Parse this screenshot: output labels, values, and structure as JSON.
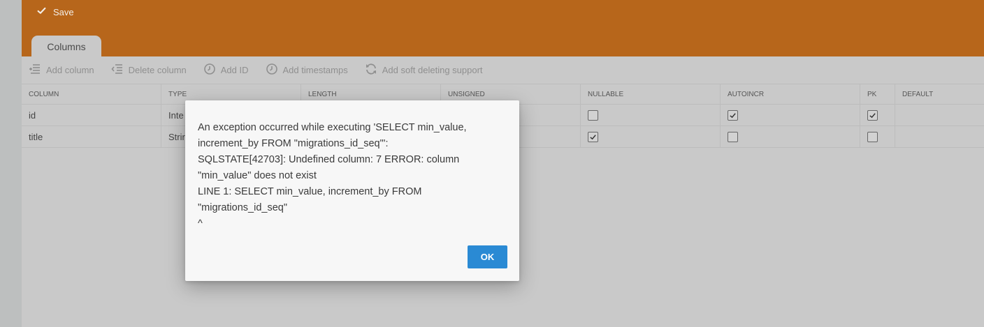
{
  "header": {
    "save_label": "Save",
    "save_icon": "check-icon"
  },
  "tabs": [
    {
      "label": "Columns"
    }
  ],
  "toolbar": {
    "items": [
      {
        "label": "Add column",
        "icon": "add-column-icon"
      },
      {
        "label": "Delete column",
        "icon": "delete-column-icon"
      },
      {
        "label": "Add ID",
        "icon": "clock-icon"
      },
      {
        "label": "Add timestamps",
        "icon": "clock-icon"
      },
      {
        "label": "Add soft deleting support",
        "icon": "refresh-icon"
      }
    ]
  },
  "table": {
    "headers": [
      "COLUMN",
      "TYPE",
      "LENGTH",
      "UNSIGNED",
      "NULLABLE",
      "AUTOINCR",
      "PK",
      "DEFAULT"
    ],
    "rows": [
      {
        "column": "id",
        "type": "Inte",
        "length": "",
        "unsigned": "",
        "nullable": false,
        "autoincr": true,
        "pk": true,
        "default": ""
      },
      {
        "column": "title",
        "type": "Strir",
        "length": "",
        "unsigned": "",
        "nullable": true,
        "autoincr": false,
        "pk": false,
        "default": ""
      }
    ]
  },
  "dialog": {
    "lines": [
      "An exception occurred while executing 'SELECT min_value, increment_by FROM \"migrations_id_seq\"':",
      "",
      "SQLSTATE[42703]: Undefined column: 7 ERROR: column \"min_value\" does not exist",
      "LINE 1: SELECT min_value, increment_by FROM \"migrations_id_seq\"",
      "^"
    ],
    "ok_label": "OK"
  },
  "colors": {
    "header_bg": "#b7661b",
    "content_bg": "#c9c9c9",
    "ok_button": "#2a8ad4",
    "dialog_bg": "#f7f7f7"
  }
}
